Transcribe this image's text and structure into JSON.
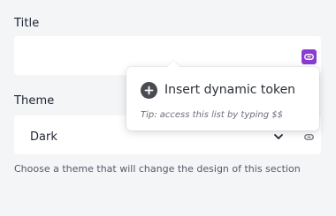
{
  "title_field": {
    "label": "Title",
    "value": "",
    "token_icon": "link-icon",
    "accent": "#8a3bd0"
  },
  "token_popover": {
    "action_label": "Insert dynamic token",
    "action_icon": "plus-circle-icon",
    "tip": "Tip: access this list by typing $$"
  },
  "theme_field": {
    "label": "Theme",
    "selected": "Dark",
    "token_icon": "link-icon",
    "help": "Choose a theme that will change the design of this section"
  }
}
